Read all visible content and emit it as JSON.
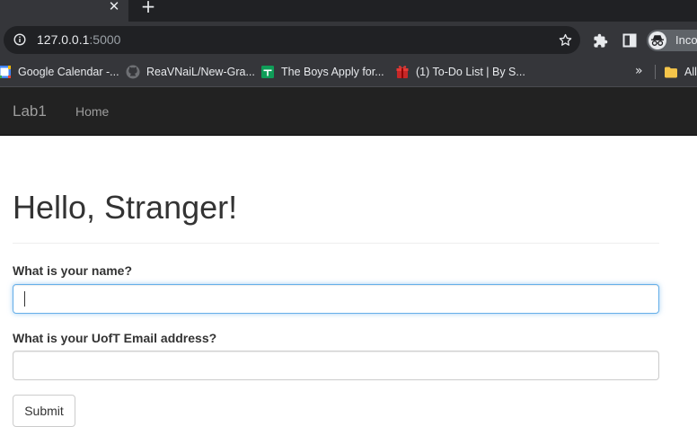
{
  "browser": {
    "tab_close_glyph": "✕",
    "new_tab_glyph": "+",
    "url_host": "127.0.0.1",
    "url_port": ":5000",
    "profile_label": "Incog",
    "bookmarks": [
      {
        "label": "Google Calendar -...",
        "icon": "google-calendar-icon"
      },
      {
        "label": "ReaVNaiL/New-Gra...",
        "icon": "github-icon"
      },
      {
        "label": "The Boys Apply for...",
        "icon": "google-sheets-icon"
      },
      {
        "label": "(1) To-Do List | By S...",
        "icon": "todo-gift-icon"
      }
    ],
    "bookmarks_more": "»",
    "all_bookmarks_label": "All"
  },
  "navbar": {
    "brand": "Lab1",
    "items": [
      {
        "label": "Home"
      }
    ]
  },
  "page": {
    "heading": "Hello, Stranger!",
    "form": {
      "name_label": "What is your name?",
      "name_value": "",
      "email_label": "What is your UofT Email address?",
      "email_value": "",
      "submit_label": "Submit"
    }
  },
  "colors": {
    "navbar_bg": "#222222",
    "navbar_text": "#9d9d9d",
    "focus_border": "#66afe9",
    "chrome_dark": "#202124",
    "chrome_toolbar": "#35363a"
  }
}
